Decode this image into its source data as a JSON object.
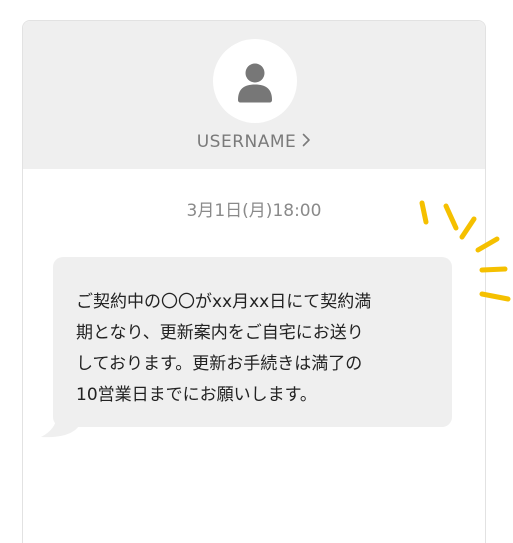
{
  "contact": {
    "username": "USERNAME",
    "avatar_icon": "person-silhouette-icon",
    "chevron_icon": "chevron-right-icon"
  },
  "conversation": {
    "timestamp": "3月1日(月)18:00",
    "messages": [
      {
        "text": "ご契約中の〇〇がxx月xx日にて契約満\n期となり、更新案内をご自宅にお送り\nしております。更新お手続きは満了の\n10営業日までにお願いします。"
      }
    ]
  },
  "decoration": {
    "icon": "notification-burst-icon",
    "color": "#f5c000"
  },
  "colors": {
    "header_bg": "#efefef",
    "bubble_bg": "#efefef",
    "avatar_fg": "#777777",
    "accent": "#f5c000"
  }
}
